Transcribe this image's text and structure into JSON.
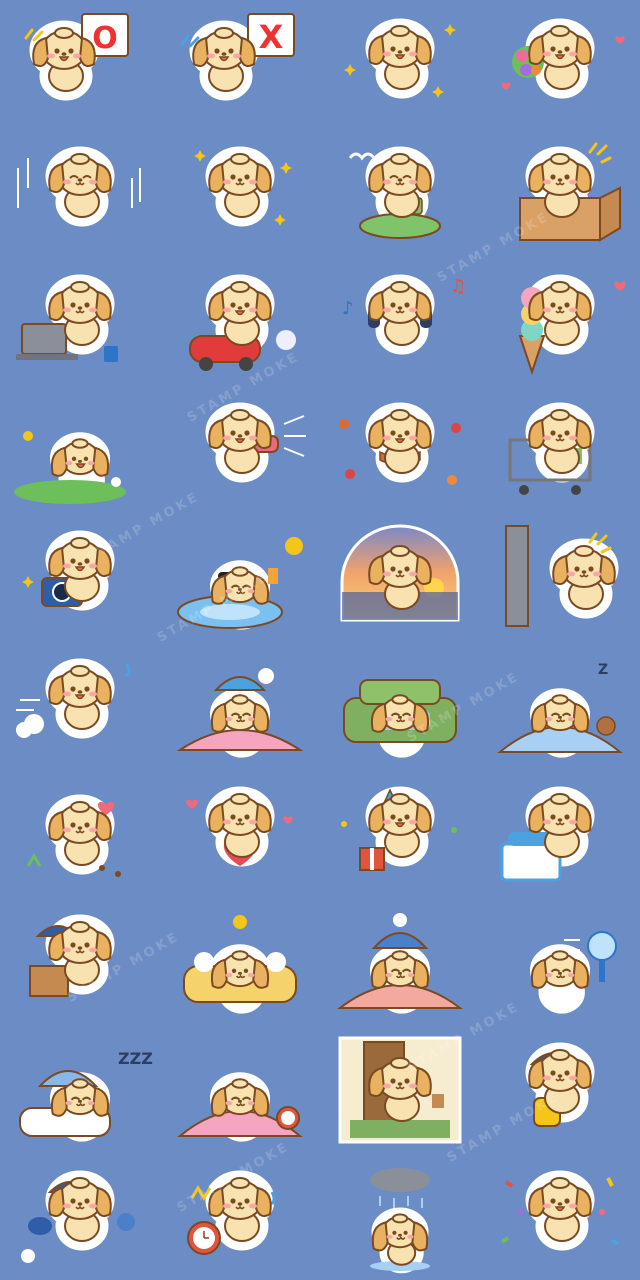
{
  "background": "#6b8cc4",
  "palette": {
    "fur": "#f8e3b0",
    "ear": "#e9b261",
    "outline": "#7a4a22",
    "blush": "#f7a7a7",
    "sticker_border": "#ffffff"
  },
  "watermark": "STAMP MOKE",
  "sign_marks": {
    "circle": "O",
    "cross": "X"
  },
  "sleep_marks": {
    "zzz": "ZZZ",
    "z": "Z"
  },
  "stickers": [
    {
      "pose": "circle-sign",
      "props": [
        "white sign with red circle"
      ]
    },
    {
      "pose": "cross-sign",
      "props": [
        "white sign with red cross"
      ]
    },
    {
      "pose": "thumbs-up",
      "props": [
        "sparkles"
      ]
    },
    {
      "pose": "bouquet",
      "props": [
        "flower bouquet",
        "hearts"
      ]
    },
    {
      "pose": "bowing",
      "props": [
        "motion lines"
      ]
    },
    {
      "pose": "pleading",
      "props": [
        "sparkles"
      ]
    },
    {
      "pose": "tea-on-cushion",
      "props": [
        "green cup",
        "green cushion",
        "steam"
      ]
    },
    {
      "pose": "in-box",
      "props": [
        "cardboard box"
      ]
    },
    {
      "pose": "laptop",
      "props": [
        "laptop",
        "blue mug"
      ]
    },
    {
      "pose": "toy-car",
      "props": [
        "red toy car",
        "exhaust puff"
      ]
    },
    {
      "pose": "headphones",
      "props": [
        "headphones",
        "music notes"
      ]
    },
    {
      "pose": "ice-cream",
      "props": [
        "triple scoop ice cream cone",
        "heart"
      ]
    },
    {
      "pose": "lying-in-grass",
      "props": [
        "grass",
        "butterfly",
        "flowers"
      ]
    },
    {
      "pose": "hair-dryer",
      "props": [
        "pink hair dryer",
        "wind lines"
      ]
    },
    {
      "pose": "autumn-scarf",
      "props": [
        "orange scarf",
        "falling leaves"
      ]
    },
    {
      "pose": "shopping-cart",
      "props": [
        "shopping cart",
        "groceries"
      ]
    },
    {
      "pose": "camera",
      "props": [
        "blue camera"
      ]
    },
    {
      "pose": "sunbathing-float",
      "props": [
        "sunglasses",
        "blue float ring",
        "juice",
        "sun"
      ]
    },
    {
      "pose": "sunset-view",
      "props": [
        "sunset sea"
      ]
    },
    {
      "pose": "peeking-wall",
      "props": [
        "grey wall"
      ]
    },
    {
      "pose": "running",
      "props": [
        "dust cloud",
        "speed lines"
      ]
    },
    {
      "pose": "under-blanket",
      "props": [
        "blue beanie",
        "pink blanket"
      ]
    },
    {
      "pose": "crying-on-sofa",
      "props": [
        "green sofa",
        "blue blanket"
      ]
    },
    {
      "pose": "sleeping-teddy",
      "props": [
        "nightcap",
        "polka dot blanket",
        "teddy bear"
      ]
    },
    {
      "pose": "back-heart",
      "props": [
        "heart",
        "grass",
        "paw prints"
      ]
    },
    {
      "pose": "holding-heart",
      "props": [
        "big red heart",
        "small hearts"
      ]
    },
    {
      "pose": "party-gift",
      "props": [
        "party hat",
        "gift box",
        "confetti"
      ]
    },
    {
      "pose": "laundry-basket",
      "props": [
        "laundry basket",
        "towels"
      ]
    },
    {
      "pose": "delivery-box",
      "props": [
        "blue cap",
        "parcel"
      ]
    },
    {
      "pose": "bubble-bath",
      "props": [
        "yellow bathtub",
        "rubber duck",
        "bubbles"
      ]
    },
    {
      "pose": "beanie-blanket",
      "props": [
        "blue beanie",
        "pink plaid blanket"
      ]
    },
    {
      "pose": "lying-fan",
      "props": [
        "electric fan",
        "wind lines"
      ]
    },
    {
      "pose": "sleeping-pillow",
      "props": [
        "nightcap",
        "white pillow",
        "zzz"
      ]
    },
    {
      "pose": "alarm-snooze",
      "props": [
        "pink blanket",
        "alarm clock"
      ]
    },
    {
      "pose": "going-out-door",
      "props": [
        "brown door",
        "green mat",
        "plant"
      ]
    },
    {
      "pose": "backpack-wave",
      "props": [
        "blue cap",
        "yellow backpack"
      ]
    },
    {
      "pose": "dropping-bag",
      "props": [
        "blue cap",
        "bag",
        "dust"
      ]
    },
    {
      "pose": "alarm-shock",
      "props": [
        "red alarm clock",
        "sweat drop"
      ]
    },
    {
      "pose": "rain-cloud",
      "props": [
        "grey rain cloud",
        "puddle"
      ]
    },
    {
      "pose": "confetti-joy",
      "props": [
        "confetti"
      ]
    }
  ]
}
